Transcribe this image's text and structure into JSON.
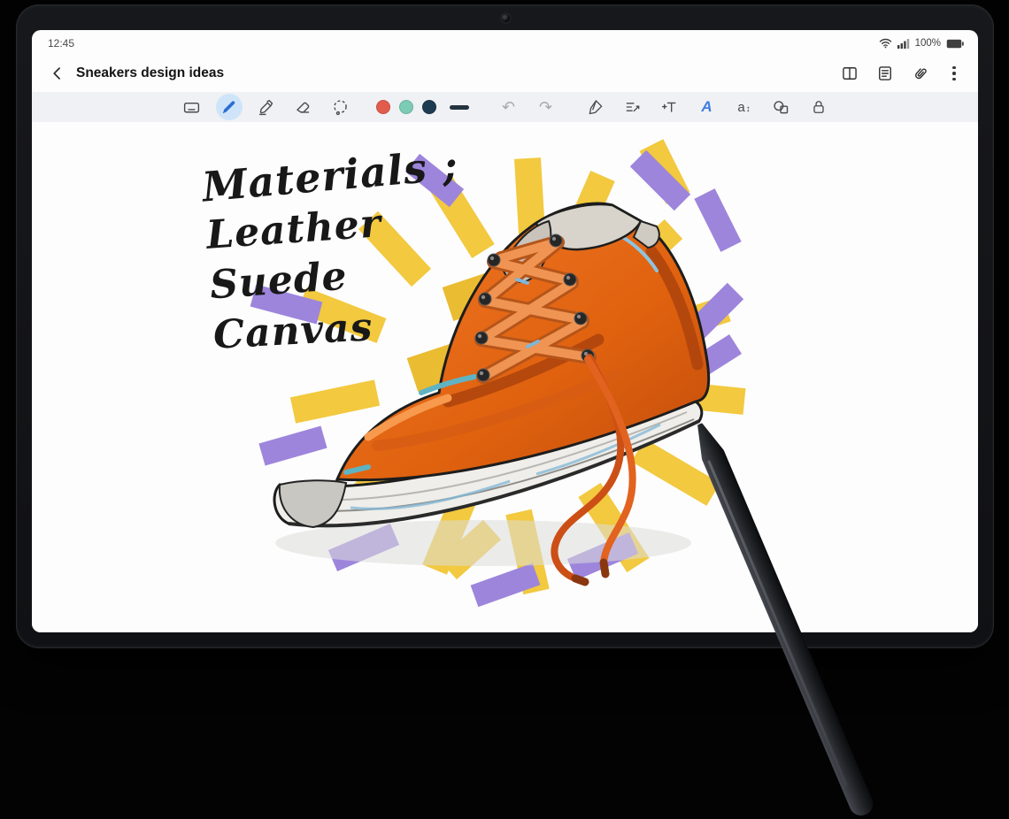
{
  "status_bar": {
    "time": "12:45",
    "battery_percent": "100%"
  },
  "header": {
    "title": "Sneakers design ideas"
  },
  "toolbar": {
    "selected_tool": "pen",
    "accent_color": "#2b6fd4",
    "selected_bg": "#cfe4f9",
    "swatches": {
      "red": "#e25c4e",
      "teal": "#7ccbb4",
      "navy": "#1d3c50"
    },
    "glyphs": {
      "undo": "↶",
      "redo": "↷",
      "assist": "A",
      "text_size": "a",
      "text_size_arrow": "↕"
    }
  },
  "canvas": {
    "handwriting": [
      "Materials ;",
      "Leather",
      "Suede",
      "Canvas"
    ]
  }
}
